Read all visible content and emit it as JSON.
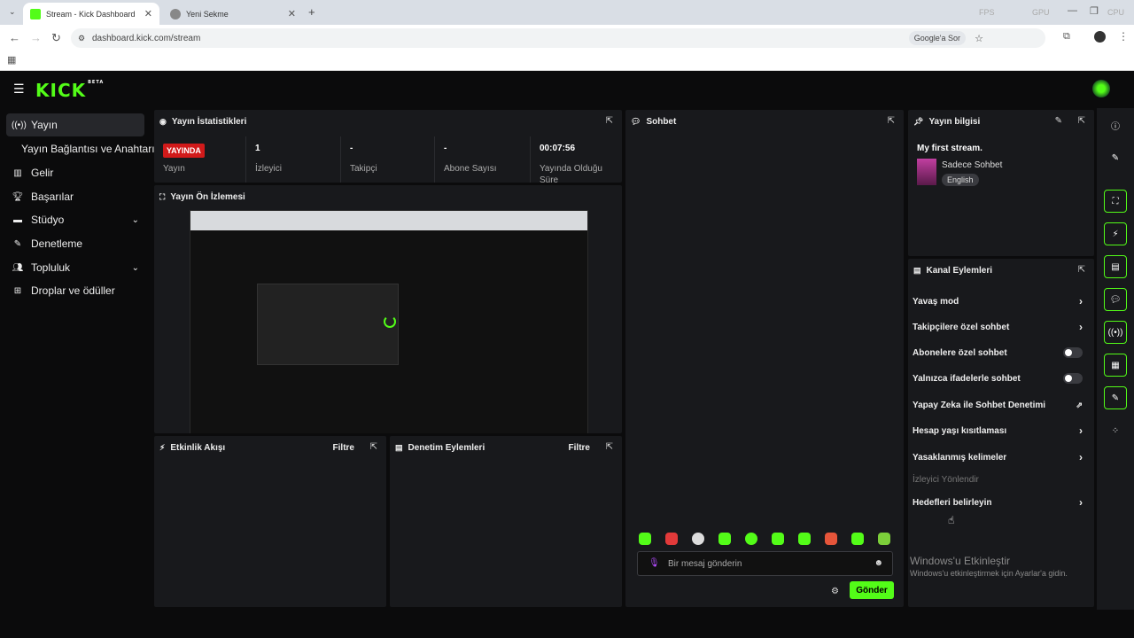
{
  "browser": {
    "tabs": [
      {
        "label": "Stream - Kick Dashboard",
        "active": true
      },
      {
        "label": "Yeni Sekme",
        "active": false
      }
    ],
    "url": "dashboard.kick.com/stream",
    "google_ask": "Google'a Sor",
    "sys": [
      "FPS",
      "GPU",
      "CPU"
    ]
  },
  "app": {
    "logo": "KICK",
    "logo_tag": "BETA",
    "sidebar": [
      {
        "label": "Yayın",
        "icon": "broadcast-icon",
        "active": true
      },
      {
        "label": "Yayın Bağlantısı ve Anahtarı",
        "icon": "",
        "active": false
      },
      {
        "label": "Gelir",
        "icon": "chart-icon",
        "active": false
      },
      {
        "label": "Başarılar",
        "icon": "trophy-icon",
        "active": false
      },
      {
        "label": "Stüdyo",
        "icon": "studio-icon",
        "active": false,
        "chevron": true
      },
      {
        "label": "Denetleme",
        "icon": "wrench-icon",
        "active": false
      },
      {
        "label": "Topluluk",
        "icon": "users-icon",
        "active": false,
        "chevron": true
      },
      {
        "label": "Droplar ve ödüller",
        "icon": "gift-icon",
        "active": false
      }
    ],
    "stats": {
      "title": "Yayın İstatistikleri",
      "live_badge": "YAYINDA",
      "items": [
        {
          "value": "",
          "label": "Yayın"
        },
        {
          "value": "1",
          "label": "İzleyici"
        },
        {
          "value": "-",
          "label": "Takipçi"
        },
        {
          "value": "-",
          "label": "Abone Sayısı"
        },
        {
          "value": "00:07:56",
          "label": "Yayında Olduğu Süre"
        }
      ]
    },
    "preview": {
      "title": "Yayın Ön İzlemesi"
    },
    "activity": {
      "title": "Etkinlik Akışı",
      "filter": "Filtre"
    },
    "modlog": {
      "title": "Denetim Eylemleri",
      "filter": "Filtre"
    },
    "chat": {
      "title": "Sohbet",
      "placeholder": "Bir mesaj gönderin",
      "send": "Gönder"
    },
    "info": {
      "title": "Yayın bilgisi",
      "stream_title": "My first stream.",
      "category": "Sadece Sohbet",
      "language": "English"
    },
    "actions": {
      "title": "Kanal Eylemleri",
      "items": [
        {
          "label": "Yavaş mod",
          "type": "chevron"
        },
        {
          "label": "Takipçilere özel sohbet",
          "type": "chevron"
        },
        {
          "label": "Abonelere özel sohbet",
          "type": "toggle"
        },
        {
          "label": "Yalnızca ifadelerle sohbet",
          "type": "toggle"
        },
        {
          "label": "Yapay Zeka ile Sohbet Denetimi",
          "type": "external"
        },
        {
          "label": "Hesap yaşı kısıtlaması",
          "type": "chevron"
        },
        {
          "label": "Yasaklanmış kelimeler",
          "type": "chevron"
        },
        {
          "label": "İzleyici Yönlendir",
          "type": "section"
        },
        {
          "label": "Hedefleri belirleyin",
          "type": "chevron"
        }
      ]
    },
    "watermark": {
      "title": "Windows'u Etkinleştir",
      "sub": "Windows'u etkinleştirmek için Ayarlar'a gidin."
    },
    "colors": {
      "accent": "#53fc18",
      "live": "#d11a1a",
      "panel": "#18191c"
    }
  }
}
